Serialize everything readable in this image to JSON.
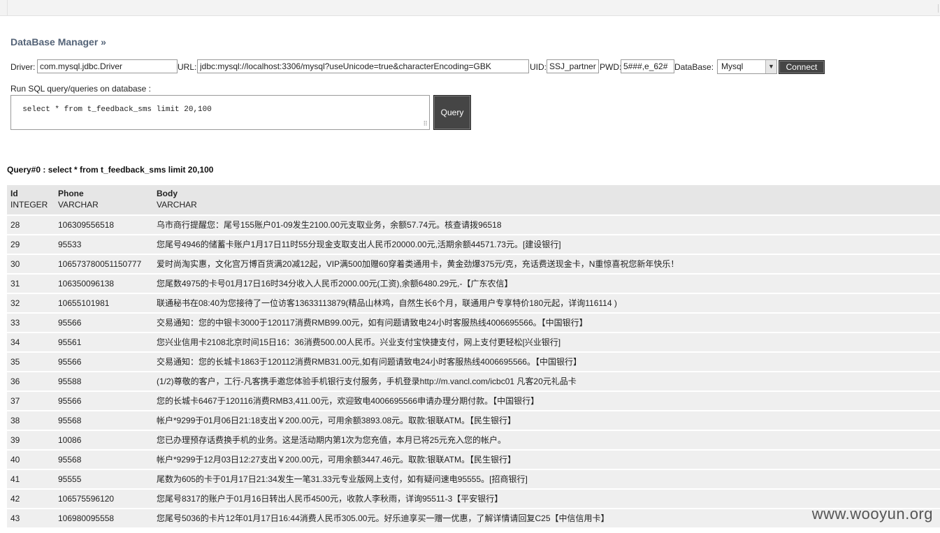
{
  "header": {
    "title": "DataBase Manager »"
  },
  "connection": {
    "driver_label": "Driver:",
    "driver_value": "com.mysql.jdbc.Driver",
    "url_label": "URL:",
    "url_value": "jdbc:mysql://localhost:3306/mysql?useUnicode=true&characterEncoding=GBK",
    "uid_label": "UID:",
    "uid_value": "SSJ_partner",
    "pwd_label": "PWD:",
    "pwd_value": "5###,e_62#",
    "db_label": "DataBase:",
    "db_selected": "Mysql",
    "connect_label": "Connect"
  },
  "query": {
    "run_label": "Run SQL query/queries on database :",
    "sql_text": "select * from t_feedback_sms limit 20,100",
    "query_button": "Query",
    "result_caption": "Query#0 : select * from t_feedback_sms limit 20,100"
  },
  "results": {
    "columns": [
      {
        "name": "Id",
        "type": "INTEGER"
      },
      {
        "name": "Phone",
        "type": "VARCHAR"
      },
      {
        "name": "Body",
        "type": "VARCHAR"
      }
    ],
    "rows": [
      [
        "28",
        "106309556518",
        "乌市商行提醒您：尾号155账户01-09发生2100.00元支取业务，余额57.74元。核查请拨96518"
      ],
      [
        "29",
        "95533",
        "您尾号4946的储蓄卡账户1月17日11时55分现金支取支出人民币20000.00元,活期余额44571.73元。[建设银行]"
      ],
      [
        "30",
        "106573780051150777",
        "爱时尚淘实惠，文化宫万博百货满20减12起，VIP满500加赠60穿着类通用卡，黄金劲爆375元/克，充话费送现金卡，N重惊喜祝您新年快乐！"
      ],
      [
        "31",
        "106350096138",
        "您尾数4975的卡号01月17日16时34分收入人民币2000.00元(工资),余额6480.29元,-【广东农信】"
      ],
      [
        "32",
        "10655101981",
        "联通秘书在08:40为您接待了一位访客13633113879(精品山林鸡，自然生长6个月，联通用户专享特价180元起，详询116114 )"
      ],
      [
        "33",
        "95566",
        "交易通知：您的中银卡3000于120117消费RMB99.00元，如有问题请致电24小时客服热线4006695566。【中国银行】"
      ],
      [
        "34",
        "95561",
        "您兴业信用卡2108北京时间15日16：36消费500.00人民币。兴业支付宝快捷支付，网上支付更轻松[兴业银行]"
      ],
      [
        "35",
        "95566",
        "交易通知：您的长城卡1863于120112消费RMB31.00元,如有问题请致电24小时客服热线4006695566。【中国银行】"
      ],
      [
        "36",
        "95588",
        "(1/2)尊敬的客户，工行-凡客携手邀您体验手机银行支付服务，手机登录http://m.vancl.com/icbc01 凡客20元礼品卡"
      ],
      [
        "37",
        "95566",
        "您的长城卡6467于120116消费RMB3,411.00元，欢迎致电4006695566申请办理分期付款。【中国银行】"
      ],
      [
        "38",
        "95568",
        "帐户*9299于01月06日21:18支出￥200.00元，可用余额3893.08元。取款:银联ATM。【民生银行】"
      ],
      [
        "39",
        "10086",
        "您已办理预存话费换手机的业务。这是活动期内第1次为您充值，本月已将25元充入您的帐户。"
      ],
      [
        "40",
        "95568",
        "帐户*9299于12月03日12:27支出￥200.00元，可用余额3447.46元。取款:银联ATM。【民生银行】"
      ],
      [
        "41",
        "95555",
        "尾数为605的卡于01月17日21:34发生一笔31.33元专业版网上支付，如有疑问速电95555。[招商银行]"
      ],
      [
        "42",
        "106575596120",
        "您尾号8317的账户于01月16日转出人民币4500元，收款人李秋雨，详询95511-3【平安银行】"
      ],
      [
        "43",
        "106980095558",
        "您尾号5036的卡片12年01月17日16:44消费人民币305.00元。好乐迪享买一赠一优惠，了解详情请回复C25【中信信用卡】"
      ]
    ]
  },
  "watermark": "www.wooyun.org"
}
